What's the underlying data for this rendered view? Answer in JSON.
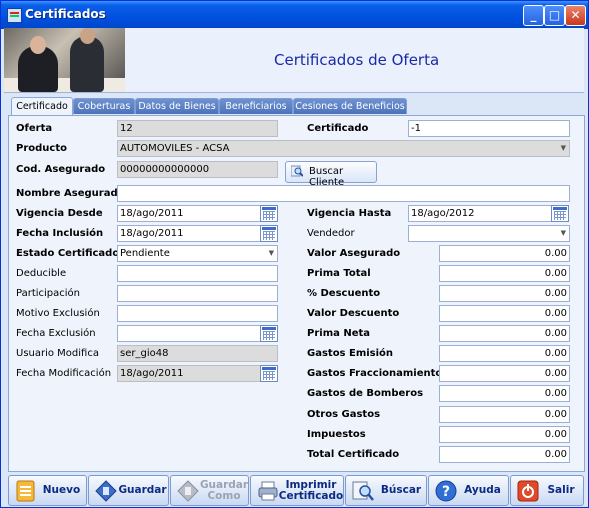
{
  "window": {
    "title": "Certificados"
  },
  "header": {
    "title": "Certificados de Oferta"
  },
  "tabs": [
    {
      "label": "Certificado"
    },
    {
      "label": "Coberturas"
    },
    {
      "label": "Datos de Bienes"
    },
    {
      "label": "Beneficiarios"
    },
    {
      "label": "Cesiones de Beneficios"
    }
  ],
  "form": {
    "oferta_label": "Oferta",
    "oferta_value": "12",
    "certificado_label": "Certificado",
    "certificado_value": "-1",
    "producto_label": "Producto",
    "producto_value": "AUTOMOVILES - ACSA",
    "cod_asegurado_label": "Cod. Asegurado",
    "cod_asegurado_value": "00000000000000",
    "buscar_cliente_label": "Buscar Cliente",
    "nombre_asegurado_label": "Nombre Asegurado",
    "nombre_asegurado_value": "",
    "vigencia_desde_label": "Vigencia Desde",
    "vigencia_desde_value": "18/ago/2011",
    "vigencia_hasta_label": "Vigencia Hasta",
    "vigencia_hasta_value": "18/ago/2012",
    "fecha_inclusion_label": "Fecha Inclusión",
    "fecha_inclusion_value": "18/ago/2011",
    "vendedor_label": "Vendedor",
    "vendedor_value": "",
    "estado_label": "Estado Certificado",
    "estado_value": "Pendiente",
    "valor_asegurado_label": "Valor Asegurado",
    "valor_asegurado_value": "0.00",
    "deducible_label": "Deducible",
    "deducible_value": "",
    "prima_total_label": "Prima Total",
    "prima_total_value": "0.00",
    "participacion_label": "Participación",
    "participacion_value": "",
    "pct_descuento_label": "% Descuento",
    "pct_descuento_value": "0.00",
    "motivo_exclusion_label": "Motivo Exclusión",
    "motivo_exclusion_value": "",
    "valor_descuento_label": "Valor Descuento",
    "valor_descuento_value": "0.00",
    "fecha_exclusion_label": "Fecha Exclusión",
    "fecha_exclusion_value": "",
    "prima_neta_label": "Prima Neta",
    "prima_neta_value": "0.00",
    "usuario_modifica_label": "Usuario Modifica",
    "usuario_modifica_value": "ser_gio48",
    "gastos_emision_label": "Gastos Emisión",
    "gastos_emision_value": "0.00",
    "fecha_modificacion_label": "Fecha Modificación",
    "fecha_modificacion_value": "18/ago/2011",
    "gastos_fraccionamiento_label": "Gastos Fraccionamiento",
    "gastos_fraccionamiento_value": "0.00",
    "gastos_bomberos_label": "Gastos de Bomberos",
    "gastos_bomberos_value": "0.00",
    "otros_gastos_label": "Otros Gastos",
    "otros_gastos_value": "0.00",
    "impuestos_label": "Impuestos",
    "impuestos_value": "0.00",
    "total_certificado_label": "Total Certificado",
    "total_certificado_value": "0.00"
  },
  "toolbar": {
    "nuevo": "Nuevo",
    "guardar": "Guardar",
    "guardar_como": "Guardar Como",
    "imprimir": "Imprimir Certificado",
    "buscar": "Búscar",
    "ayuda": "Ayuda",
    "salir": "Salir"
  }
}
